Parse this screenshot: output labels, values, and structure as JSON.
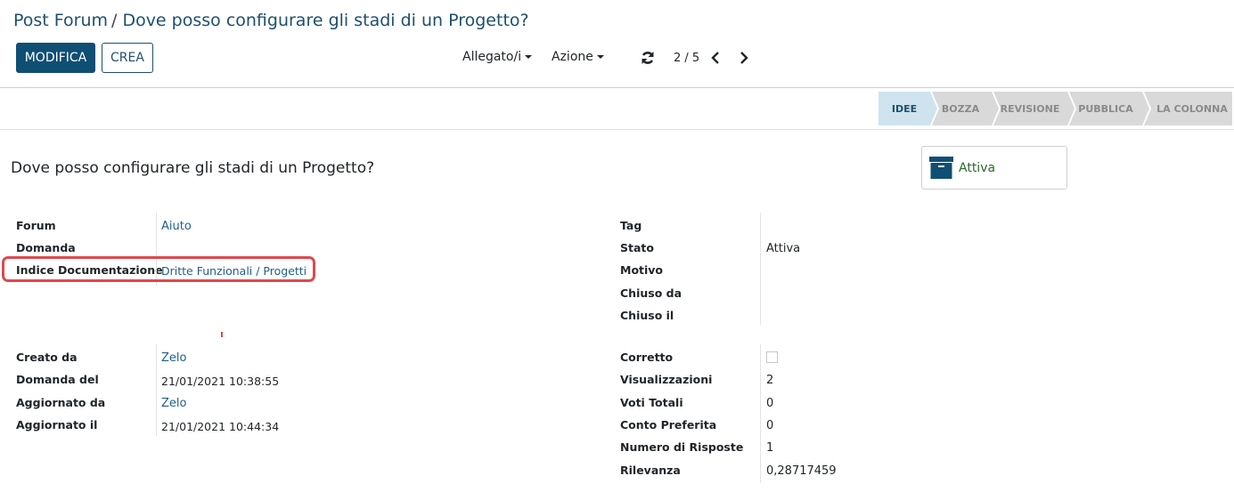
{
  "breadcrumb": {
    "parent": "Post Forum",
    "separator": "/",
    "current": "Dove posso configurare gli stadi di un Progetto?"
  },
  "toolbar": {
    "edit_label": "MODIFICA",
    "create_label": "CREA",
    "attachments_label": "Allegato/i",
    "action_label": "Azione"
  },
  "pager": {
    "value": "2 / 5"
  },
  "stages": [
    "IDEE",
    "BOZZA",
    "REVISIONE",
    "PUBBLICA",
    "LA COLONNA"
  ],
  "active_stage": "IDEE",
  "record": {
    "title": "Dove posso configurare gli stadi di un Progetto?"
  },
  "smart_button": {
    "label": "Attiva",
    "icon": "archive-box-icon"
  },
  "left_group_1": [
    {
      "label": "Forum",
      "value": "Aiuto"
    },
    {
      "label": "Domanda",
      "value": ""
    },
    {
      "label": "Indice Documentazione",
      "value": "Dritte Funzionali / Progetti"
    }
  ],
  "right_group_1": [
    {
      "label": "Tag",
      "value": ""
    },
    {
      "label": "Stato",
      "value": "Attiva"
    },
    {
      "label": "Motivo",
      "value": ""
    },
    {
      "label": "Chiuso da",
      "value": ""
    },
    {
      "label": "Chiuso il",
      "value": ""
    }
  ],
  "left_group_2": [
    {
      "label": "Creato da",
      "value": "Zelo"
    },
    {
      "label": "Domanda del",
      "value": "21/01/2021 10:38:55"
    },
    {
      "label": "Aggiornato da",
      "value": "Zelo"
    },
    {
      "label": "Aggiornato il",
      "value": "21/01/2021 10:44:34"
    }
  ],
  "right_group_2": [
    {
      "label": "Corretto",
      "value": ""
    },
    {
      "label": "Visualizzazioni",
      "value": "2"
    },
    {
      "label": "Voti Totali",
      "value": "0"
    },
    {
      "label": "Conto Preferita",
      "value": "0"
    },
    {
      "label": "Numero di Risposte",
      "value": "1"
    },
    {
      "label": "Rilevanza",
      "value": "0,28717459"
    }
  ],
  "colors": {
    "primary": "#0f4f73",
    "link": "#1e5f8a",
    "active_stage_bg": "#cfe3ef",
    "inactive_stage_bg": "#d9d9d9",
    "highlight": "#e0484c",
    "smart_button_text": "#2a6b2a"
  }
}
